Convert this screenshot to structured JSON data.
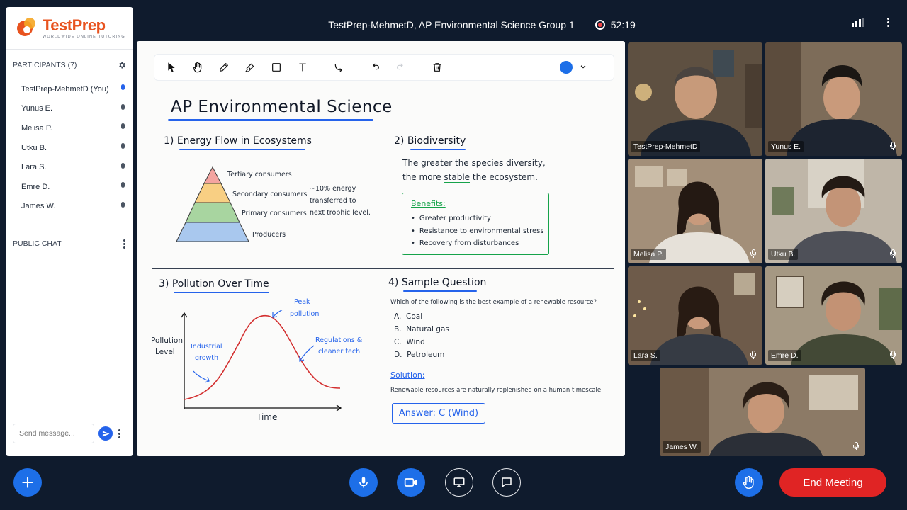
{
  "brand": {
    "name": "TestPrep",
    "tagline": "WORLDWIDE ONLINE TUTORING"
  },
  "meeting": {
    "title": "TestPrep-MehmetD, AP Environmental Science Group 1",
    "timer": "52:19"
  },
  "participants": {
    "header": "PARTICIPANTS (7)",
    "list": [
      {
        "name": "TestPrep-MehmetD (You)",
        "mic": "active"
      },
      {
        "name": "Yunus E.",
        "mic": "idle"
      },
      {
        "name": "Melisa P.",
        "mic": "idle"
      },
      {
        "name": "Utku B.",
        "mic": "idle"
      },
      {
        "name": "Lara S.",
        "mic": "idle"
      },
      {
        "name": "Emre D.",
        "mic": "idle"
      },
      {
        "name": "James W.",
        "mic": "idle"
      }
    ]
  },
  "chat": {
    "header": "PUBLIC CHAT",
    "placeholder": "Send message..."
  },
  "toolbar": {
    "tools": [
      "select-icon",
      "hand-icon",
      "pencil-icon",
      "highlighter-icon",
      "rectangle-icon",
      "text-icon",
      "connector-icon",
      "undo-icon",
      "redo-icon",
      "trash-icon"
    ],
    "color": "#1d6fe8"
  },
  "whiteboard": {
    "title": "AP Environmental Science",
    "s1": {
      "title": "1) Energy Flow in Ecosystems",
      "levels": [
        "Tertiary consumers",
        "Secondary consumers",
        "Primary consumers",
        "Producers"
      ],
      "note": [
        "~10% energy",
        "transferred to",
        "next trophic level."
      ]
    },
    "s2": {
      "title": "2) Biodiversity",
      "line1": "The greater the species diversity,",
      "line2_pre": "the more",
      "line2_em": "stable",
      "line2_post": "the ecosystem.",
      "benefits_title": "Benefits:",
      "benefits": [
        "Greater productivity",
        "Resistance to environmental stress",
        "Recovery from disturbances"
      ]
    },
    "s3": {
      "title": "3) Pollution Over Time",
      "ylabel": [
        "Pollution",
        "Level"
      ],
      "xlabel": "Time",
      "ann_peak": [
        "Peak",
        "pollution"
      ],
      "ann_growth": [
        "Industrial",
        "growth"
      ],
      "ann_reg": [
        "Regulations &",
        "cleaner tech"
      ]
    },
    "s4": {
      "title": "4) Sample Question",
      "question": "Which of the following is the best example of a renewable resource?",
      "options": [
        "A.  Coal",
        "B.  Natural gas",
        "C.  Wind",
        "D.  Petroleum"
      ],
      "solution_label": "Solution:",
      "solution_text": "Renewable resources are naturally replenished on a human timescale.",
      "answer": "Answer: C (Wind)"
    }
  },
  "videos": [
    {
      "name": "TestPrep-MehmetD",
      "muted": false
    },
    {
      "name": "Yunus E.",
      "muted": true
    },
    {
      "name": "Melisa P.",
      "muted": true
    },
    {
      "name": "Utku B.",
      "muted": true
    },
    {
      "name": "Lara S.",
      "muted": true
    },
    {
      "name": "Emre D.",
      "muted": true
    },
    {
      "name": "James W.",
      "muted": true
    }
  ],
  "controls": {
    "end_label": "End Meeting"
  },
  "colors": {
    "background": "#0f1b2d",
    "accent": "#1d6fe8",
    "end": "#e02424",
    "brand": "#e8531f"
  }
}
